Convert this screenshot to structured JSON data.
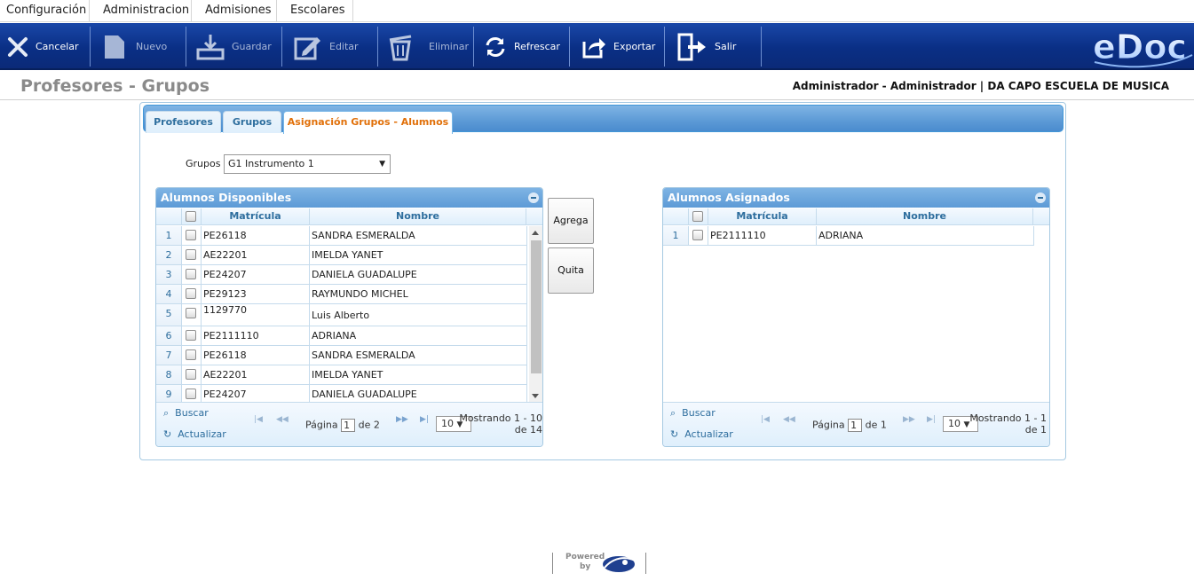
{
  "menu": [
    "Configuración",
    "Administracion",
    "Admisiones",
    "Escolares"
  ],
  "toolbar": {
    "cancelar": "Cancelar",
    "nuevo": "Nuevo",
    "guardar": "Guardar",
    "editar": "Editar",
    "eliminar": "Eliminar",
    "refrescar": "Refrescar",
    "exportar": "Exportar",
    "salir": "Salir",
    "logo": "eDoc"
  },
  "page": {
    "title": "Profesores - Grupos",
    "user": "Administrador - Administrador | DA CAPO ESCUELA DE MUSICA"
  },
  "tabs": [
    "Profesores",
    "Grupos",
    "Asignación Grupos - Alumnos"
  ],
  "grupo": {
    "label": "Grupos",
    "value": "G1 Instrumento 1"
  },
  "disponibles": {
    "caption": "Alumnos Disponibles",
    "col_matricula": "Matrícula",
    "col_nombre": "Nombre",
    "rows": [
      {
        "n": "1",
        "mat": "PE26118",
        "nom": "SANDRA ESMERALDA"
      },
      {
        "n": "2",
        "mat": "AE22201",
        "nom": "IMELDA YANET"
      },
      {
        "n": "3",
        "mat": "PE24207",
        "nom": "DANIELA GUADALUPE"
      },
      {
        "n": "4",
        "mat": "PE29123",
        "nom": "RAYMUNDO MICHEL"
      },
      {
        "n": "5",
        "mat": "1129770",
        "nom": "Luis Alberto"
      },
      {
        "n": "6",
        "mat": "PE2111110",
        "nom": "ADRIANA"
      },
      {
        "n": "7",
        "mat": "PE26118",
        "nom": "SANDRA ESMERALDA"
      },
      {
        "n": "8",
        "mat": "AE22201",
        "nom": "IMELDA YANET"
      },
      {
        "n": "9",
        "mat": "PE24207",
        "nom": "DANIELA GUADALUPE"
      }
    ],
    "buscar": "Buscar",
    "actualizar": "Actualizar",
    "pagina_label": "Página",
    "pagina_value": "1",
    "de_label": "de 2",
    "rows_per_page": "10",
    "mostrando_1": "Mostrando 1 - 10",
    "mostrando_2": "de 14"
  },
  "asignados": {
    "caption": "Alumnos Asignados",
    "col_matricula": "Matrícula",
    "col_nombre": "Nombre",
    "rows": [
      {
        "n": "1",
        "mat": "PE2111110",
        "nom": "ADRIANA"
      }
    ],
    "buscar": "Buscar",
    "actualizar": "Actualizar",
    "pagina_label": "Página",
    "pagina_value": "1",
    "de_label": "de 1",
    "rows_per_page": "10",
    "mostrando_1": "Mostrando 1 - 1",
    "mostrando_2": "de 1"
  },
  "buttons": {
    "agrega": "Agrega",
    "quita": "Quita"
  },
  "footer": {
    "powered": "Powered",
    "by": "by"
  }
}
